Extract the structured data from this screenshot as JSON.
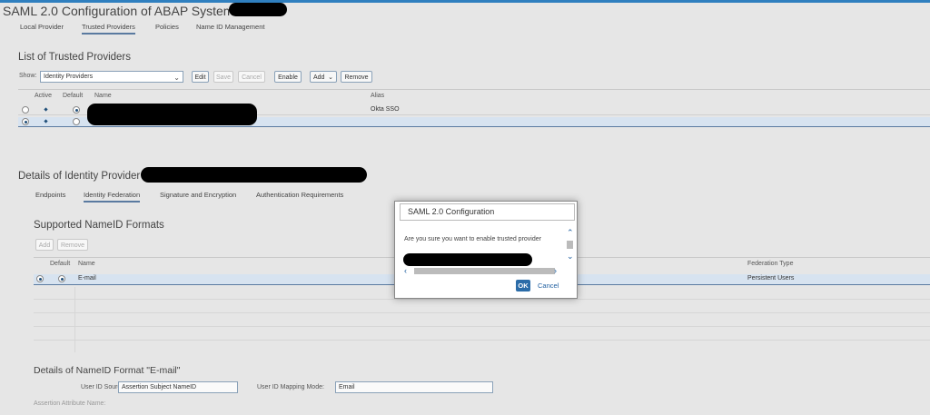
{
  "header": {
    "title": "SAML 2.0 Configuration of ABAP System:"
  },
  "top_tabs": [
    "Local Provider",
    "Trusted Providers",
    "Policies",
    "Name ID Management"
  ],
  "trusted_list": {
    "title": "List of Trusted Providers",
    "show_label": "Show:",
    "show_value": "Identity Providers",
    "buttons": [
      "Edit",
      "Save",
      "Cancel",
      "Enable",
      "Add",
      "Remove"
    ],
    "columns": [
      "Active",
      "Default",
      "Name",
      "Alias"
    ],
    "rows": [
      {
        "alias": "Okta SSO"
      },
      {
        "alias": ""
      }
    ]
  },
  "details": {
    "title": "Details of Identity Provider",
    "tabs": [
      "Endpoints",
      "Identity Federation",
      "Signature and Encryption",
      "Authentication Requirements"
    ]
  },
  "nameid": {
    "title": "Supported NameID Formats",
    "buttons": [
      "Add",
      "Remove"
    ],
    "columns": [
      "Default",
      "Name",
      "Federation Type"
    ],
    "rows": [
      {
        "name": "E-mail",
        "federation_type": "Persistent Users"
      }
    ]
  },
  "nameid_details": {
    "title": "Details of NameID Format \"E-mail\"",
    "user_id_source_label": "User ID Source:",
    "user_id_source_value": "Assertion Subject NameID",
    "mapping_mode_label": "User ID Mapping Mode:",
    "mapping_mode_value": "Email",
    "assertion_attr_label": "Assertion Attribute Name:"
  },
  "dialog": {
    "title": "SAML 2.0 Configuration",
    "message": "Are you sure you want to enable trusted provider",
    "ok_label": "OK",
    "cancel_label": "Cancel"
  },
  "icons": {
    "dropdown": "chevron-down-icon",
    "scroll_up": "chevron-up-icon",
    "scroll_down": "chevron-down-icon",
    "scroll_left": "chevron-left-icon",
    "scroll_right": "chevron-right-icon"
  },
  "colors": {
    "accent": "#2b6ca8",
    "link": "#1f5fa0",
    "selection": "#d7e3f0"
  }
}
